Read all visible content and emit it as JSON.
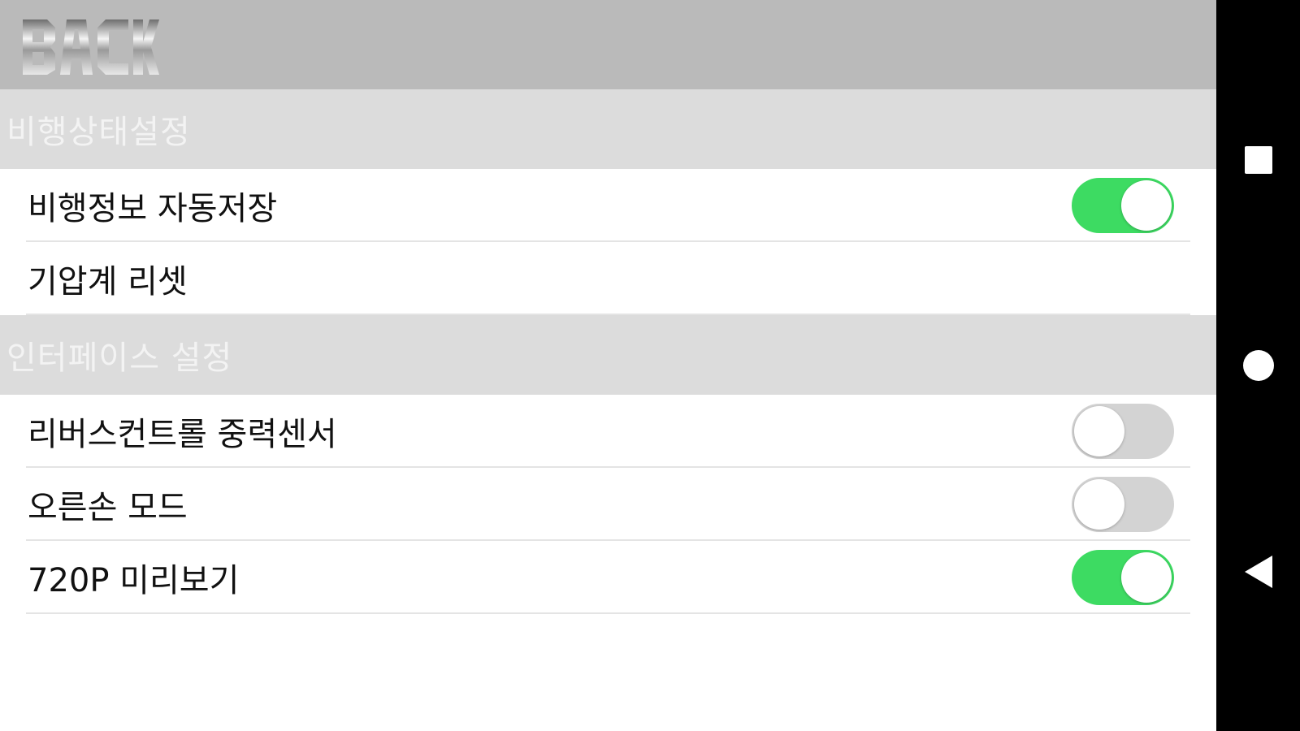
{
  "header": {
    "back_label": "BACK"
  },
  "sections": [
    {
      "title": "비행상태설정",
      "items": [
        {
          "label": "비행정보 자동저장",
          "toggle": true
        },
        {
          "label": "기압계 리셋"
        }
      ]
    },
    {
      "title": "인터페이스 설정",
      "items": [
        {
          "label": "리버스컨트롤 중력센서",
          "toggle": false
        },
        {
          "label": "오른손 모드",
          "toggle": false
        },
        {
          "label": "720P 미리보기",
          "toggle": true
        }
      ]
    }
  ],
  "navbar": {
    "icons": [
      "square-recents-icon",
      "circle-home-icon",
      "triangle-back-icon"
    ]
  },
  "colors": {
    "header_bg": "#bababa",
    "section_bg": "#dcdcdc",
    "toggle_on": "#3ddb62",
    "toggle_off": "#d3d3d3",
    "navbar_bg": "#000000"
  }
}
